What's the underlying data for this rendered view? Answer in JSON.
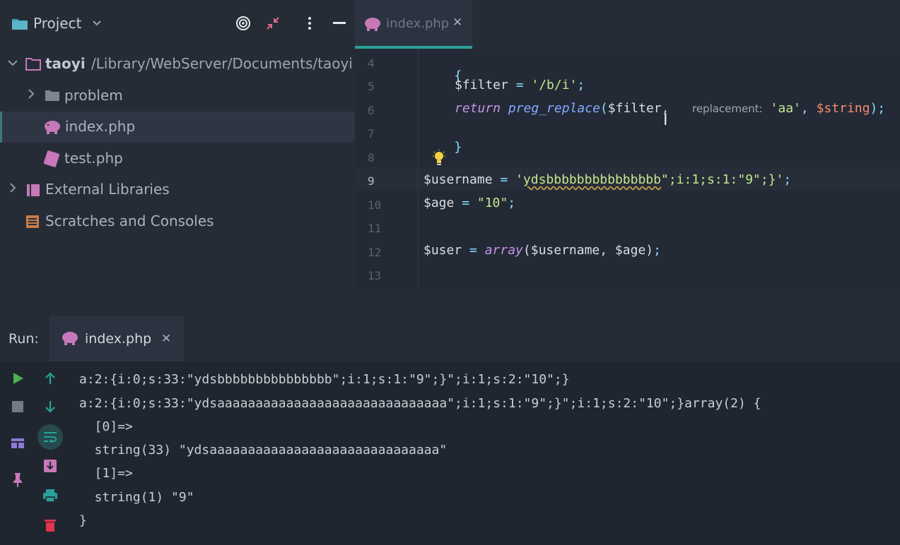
{
  "project": {
    "title": "Project",
    "tree": {
      "root_name": "taoyi",
      "root_path": "/Library/WebServer/Documents/taoyi",
      "items": [
        {
          "label": "problem"
        },
        {
          "label": "index.php"
        },
        {
          "label": "test.php"
        },
        {
          "label": "External Libraries"
        },
        {
          "label": "Scratches and Consoles"
        }
      ]
    }
  },
  "editor": {
    "tab_label": "index.php",
    "line_numbers": [
      "4",
      "5",
      "6",
      "7",
      "8",
      "9",
      "10",
      "11",
      "12",
      "13"
    ],
    "code": {
      "l4": "{",
      "l5_var": "$filter",
      "l5_op": " = ",
      "l5_str": "'/b/i'",
      "l5_end": ";",
      "l6_kw": "return",
      "l6_fn": "preg_replace",
      "l6_open": "(",
      "l6_var": "$filter",
      "l6_comma": ",",
      "l6_hint": "replacement:",
      "l6_str": "'aa'",
      "l6_comma2": ", ",
      "l6_var2": "$string",
      "l6_close": ");",
      "l7": "}",
      "l9_var": "$username",
      "l9_op": " = ",
      "l9_q": "'",
      "l9_squig": "ydsbbbbbbbbbbbbbbb",
      "l9_rest": "\";i:1;s:1:\"9\";}'",
      "l9_end": ";",
      "l10_var": "$age",
      "l10_op": " = ",
      "l10_str": "\"10\"",
      "l10_end": ";",
      "l12_var": "$user",
      "l12_op": " = ",
      "l12_kw": "array",
      "l12_args": "($username, $age)",
      "l12_end": ";"
    }
  },
  "run": {
    "label": "Run:",
    "tab_label": "index.php",
    "output": [
      "a:2:{i:0;s:33:\"ydsbbbbbbbbbbbbbbb\";i:1;s:1:\"9\";}\";i:1;s:2:\"10\";}",
      "a:2:{i:0;s:33:\"ydsaaaaaaaaaaaaaaaaaaaaaaaaaaaaaa\";i:1;s:1:\"9\";}\";i:1;s:2:\"10\";}array(2) {",
      "  [0]=>",
      "  string(33) \"ydsaaaaaaaaaaaaaaaaaaaaaaaaaaaaaa\"",
      "  [1]=>",
      "  string(1) \"9\"",
      "}"
    ]
  },
  "colors": {
    "accent": "#2aa198",
    "php_icon": "#c678b9",
    "run_green": "#4caf50"
  },
  "icons": [
    "folder-icon",
    "chevron-down-icon",
    "target-icon",
    "collapse-icon",
    "kebab-icon",
    "minimize-icon",
    "php-elephant-icon",
    "php-file-icon",
    "library-icon",
    "scratch-icon",
    "close-icon",
    "lightbulb-icon",
    "play-icon",
    "stop-icon",
    "arrow-up-icon",
    "arrow-down-icon",
    "soft-wrap-icon",
    "layout-icon",
    "scroll-end-icon",
    "pin-icon",
    "print-icon",
    "trash-icon"
  ]
}
